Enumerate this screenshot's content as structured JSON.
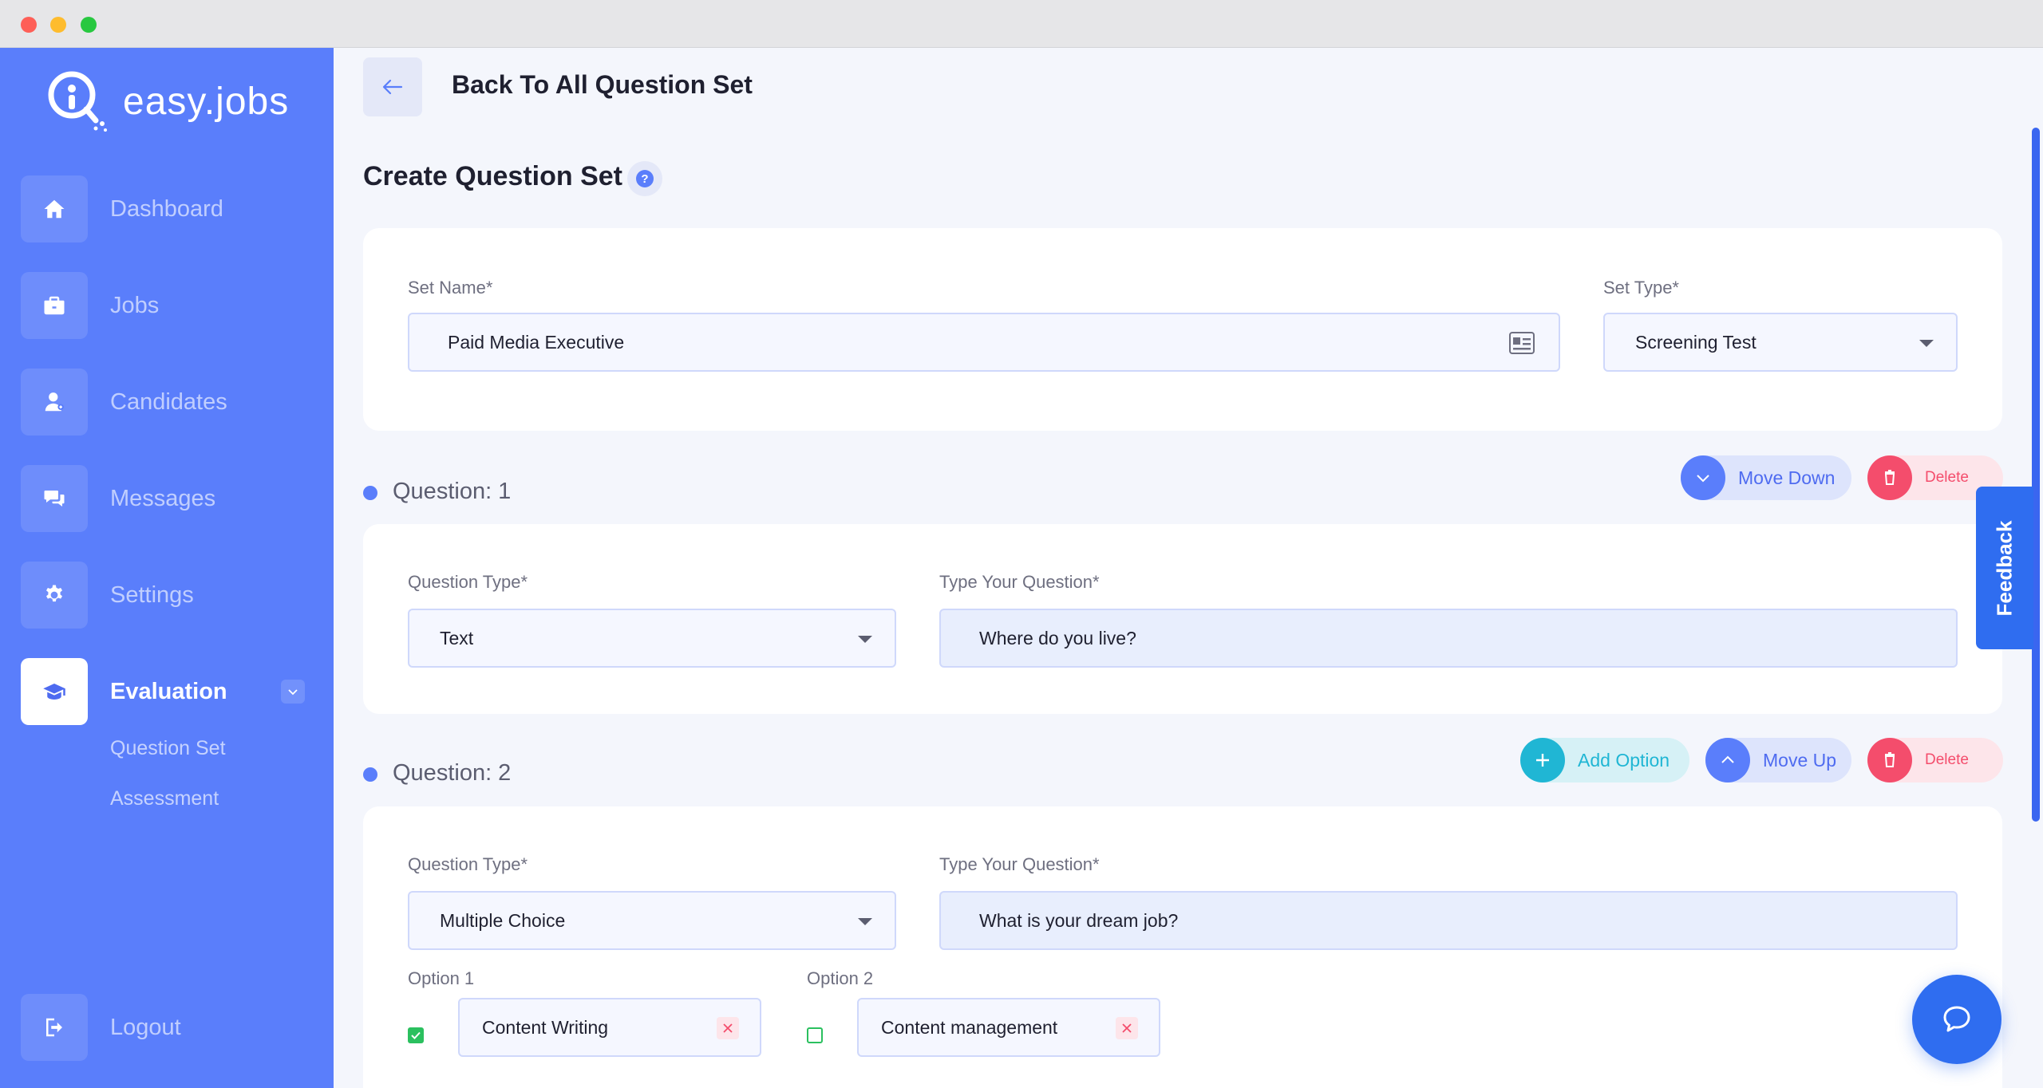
{
  "brand": {
    "name": "easy.jobs"
  },
  "sidebar": {
    "items": [
      {
        "label": "Dashboard",
        "icon": "home-icon"
      },
      {
        "label": "Jobs",
        "icon": "briefcase-icon"
      },
      {
        "label": "Candidates",
        "icon": "user-icon"
      },
      {
        "label": "Messages",
        "icon": "chat-icon"
      },
      {
        "label": "Settings",
        "icon": "gear-icon"
      },
      {
        "label": "Evaluation",
        "icon": "graduation-cap-icon"
      }
    ],
    "sub_items": [
      "Question Set",
      "Assessment"
    ],
    "logout": "Logout"
  },
  "header": {
    "back_label": "Back To All Question Set"
  },
  "page": {
    "title": "Create Question Set"
  },
  "set_form": {
    "name_label": "Set Name*",
    "name_value": "Paid Media Executive",
    "type_label": "Set Type*",
    "type_value": "Screening Test"
  },
  "questions": [
    {
      "title": "Question: 1",
      "type_label": "Question Type*",
      "type_value": "Text",
      "question_label": "Type Your Question*",
      "question_value": "Where do you live?",
      "actions": {
        "move": "Move Down",
        "delete": "Delete"
      }
    },
    {
      "title": "Question: 2",
      "type_label": "Question Type*",
      "type_value": "Multiple Choice",
      "question_label": "Type Your Question*",
      "question_value": "What is your dream job?",
      "actions": {
        "add": "Add Option",
        "move": "Move Up",
        "delete": "Delete"
      },
      "options": [
        {
          "label": "Option 1",
          "value": "Content Writing",
          "checked": true
        },
        {
          "label": "Option 2",
          "value": "Content management",
          "checked": false
        }
      ]
    }
  ],
  "feedback": "Feedback",
  "colors": {
    "sidebar": "#5a7efb",
    "accent": "#2f6df0",
    "danger": "#f44d6c",
    "teal": "#20b6d4",
    "success": "#2bc05f"
  }
}
